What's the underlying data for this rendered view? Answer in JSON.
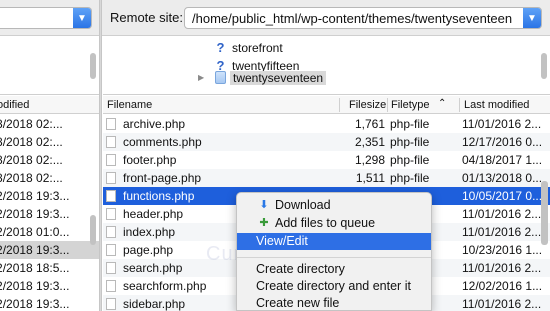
{
  "remote": {
    "label": "Remote site:",
    "path": "/home/public_html/wp-content/themes/twentyseventeen"
  },
  "remote_tree": [
    {
      "name": "storefront",
      "icon": "question-folder-icon"
    },
    {
      "name": "twentyfifteen",
      "icon": "question-folder-icon"
    },
    {
      "name": "twentyseventeen",
      "icon": "folder-icon",
      "selected": true
    }
  ],
  "local_header": {
    "modified": "odified"
  },
  "local_rows": [
    "/2018 02:...",
    "/2018 02:...",
    "/2018 02:...",
    "/2018 02:...",
    "/2018 19:3...",
    "/2018 19:3...",
    "/2018 01:0...",
    "/2018 19:3...",
    "/2018 18:5...",
    "/2018 19:3...",
    "/2018 19:3...",
    "/2018 19:3..."
  ],
  "local_rows_prefix": [
    "8",
    "8",
    "8",
    "8",
    "2",
    "2",
    "2",
    "2",
    "2",
    "2",
    "2",
    "2"
  ],
  "remote_header": {
    "filename": "Filename",
    "filesize": "Filesize",
    "filetype": "Filetype",
    "sort_icon": "caret-up-icon",
    "modified": "Last modified"
  },
  "files": [
    {
      "name": "archive.php",
      "size": "1,761",
      "type": "php-file",
      "modified": "11/01/2016 2..."
    },
    {
      "name": "comments.php",
      "size": "2,351",
      "type": "php-file",
      "modified": "12/17/2016 0..."
    },
    {
      "name": "footer.php",
      "size": "1,298",
      "type": "php-file",
      "modified": "04/18/2017 1..."
    },
    {
      "name": "front-page.php",
      "size": "1,511",
      "type": "php-file",
      "modified": "01/13/2018 0..."
    },
    {
      "name": "functions.php",
      "size": "",
      "type": "",
      "modified": "10/05/2017 0...",
      "selected": true
    },
    {
      "name": "header.php",
      "size": "",
      "type": "",
      "modified": "11/01/2016 2..."
    },
    {
      "name": "index.php",
      "size": "",
      "type": "",
      "modified": "11/01/2016 2..."
    },
    {
      "name": "page.php",
      "size": "",
      "type": "",
      "modified": "10/23/2016 1..."
    },
    {
      "name": "search.php",
      "size": "",
      "type": "",
      "modified": "11/01/2016 2..."
    },
    {
      "name": "searchform.php",
      "size": "",
      "type": "",
      "modified": "12/02/2016 1..."
    },
    {
      "name": "sidebar.php",
      "size": "",
      "type": "",
      "modified": "11/01/2016 2..."
    }
  ],
  "context_menu": {
    "items": [
      {
        "label": "Download",
        "icon": "download-arrow-icon"
      },
      {
        "label": "Add files to queue",
        "icon": "add-queue-icon"
      },
      {
        "label": "View/Edit",
        "highlighted": true
      },
      {
        "label": "Create directory"
      },
      {
        "label": "Create directory and enter it"
      },
      {
        "label": "Create new file"
      }
    ]
  },
  "watermark": "CursusWP.com",
  "colors": {
    "selection": "#1e5fdc",
    "menu_highlight": "#2e6fe5",
    "accent": "#2a74e6"
  }
}
